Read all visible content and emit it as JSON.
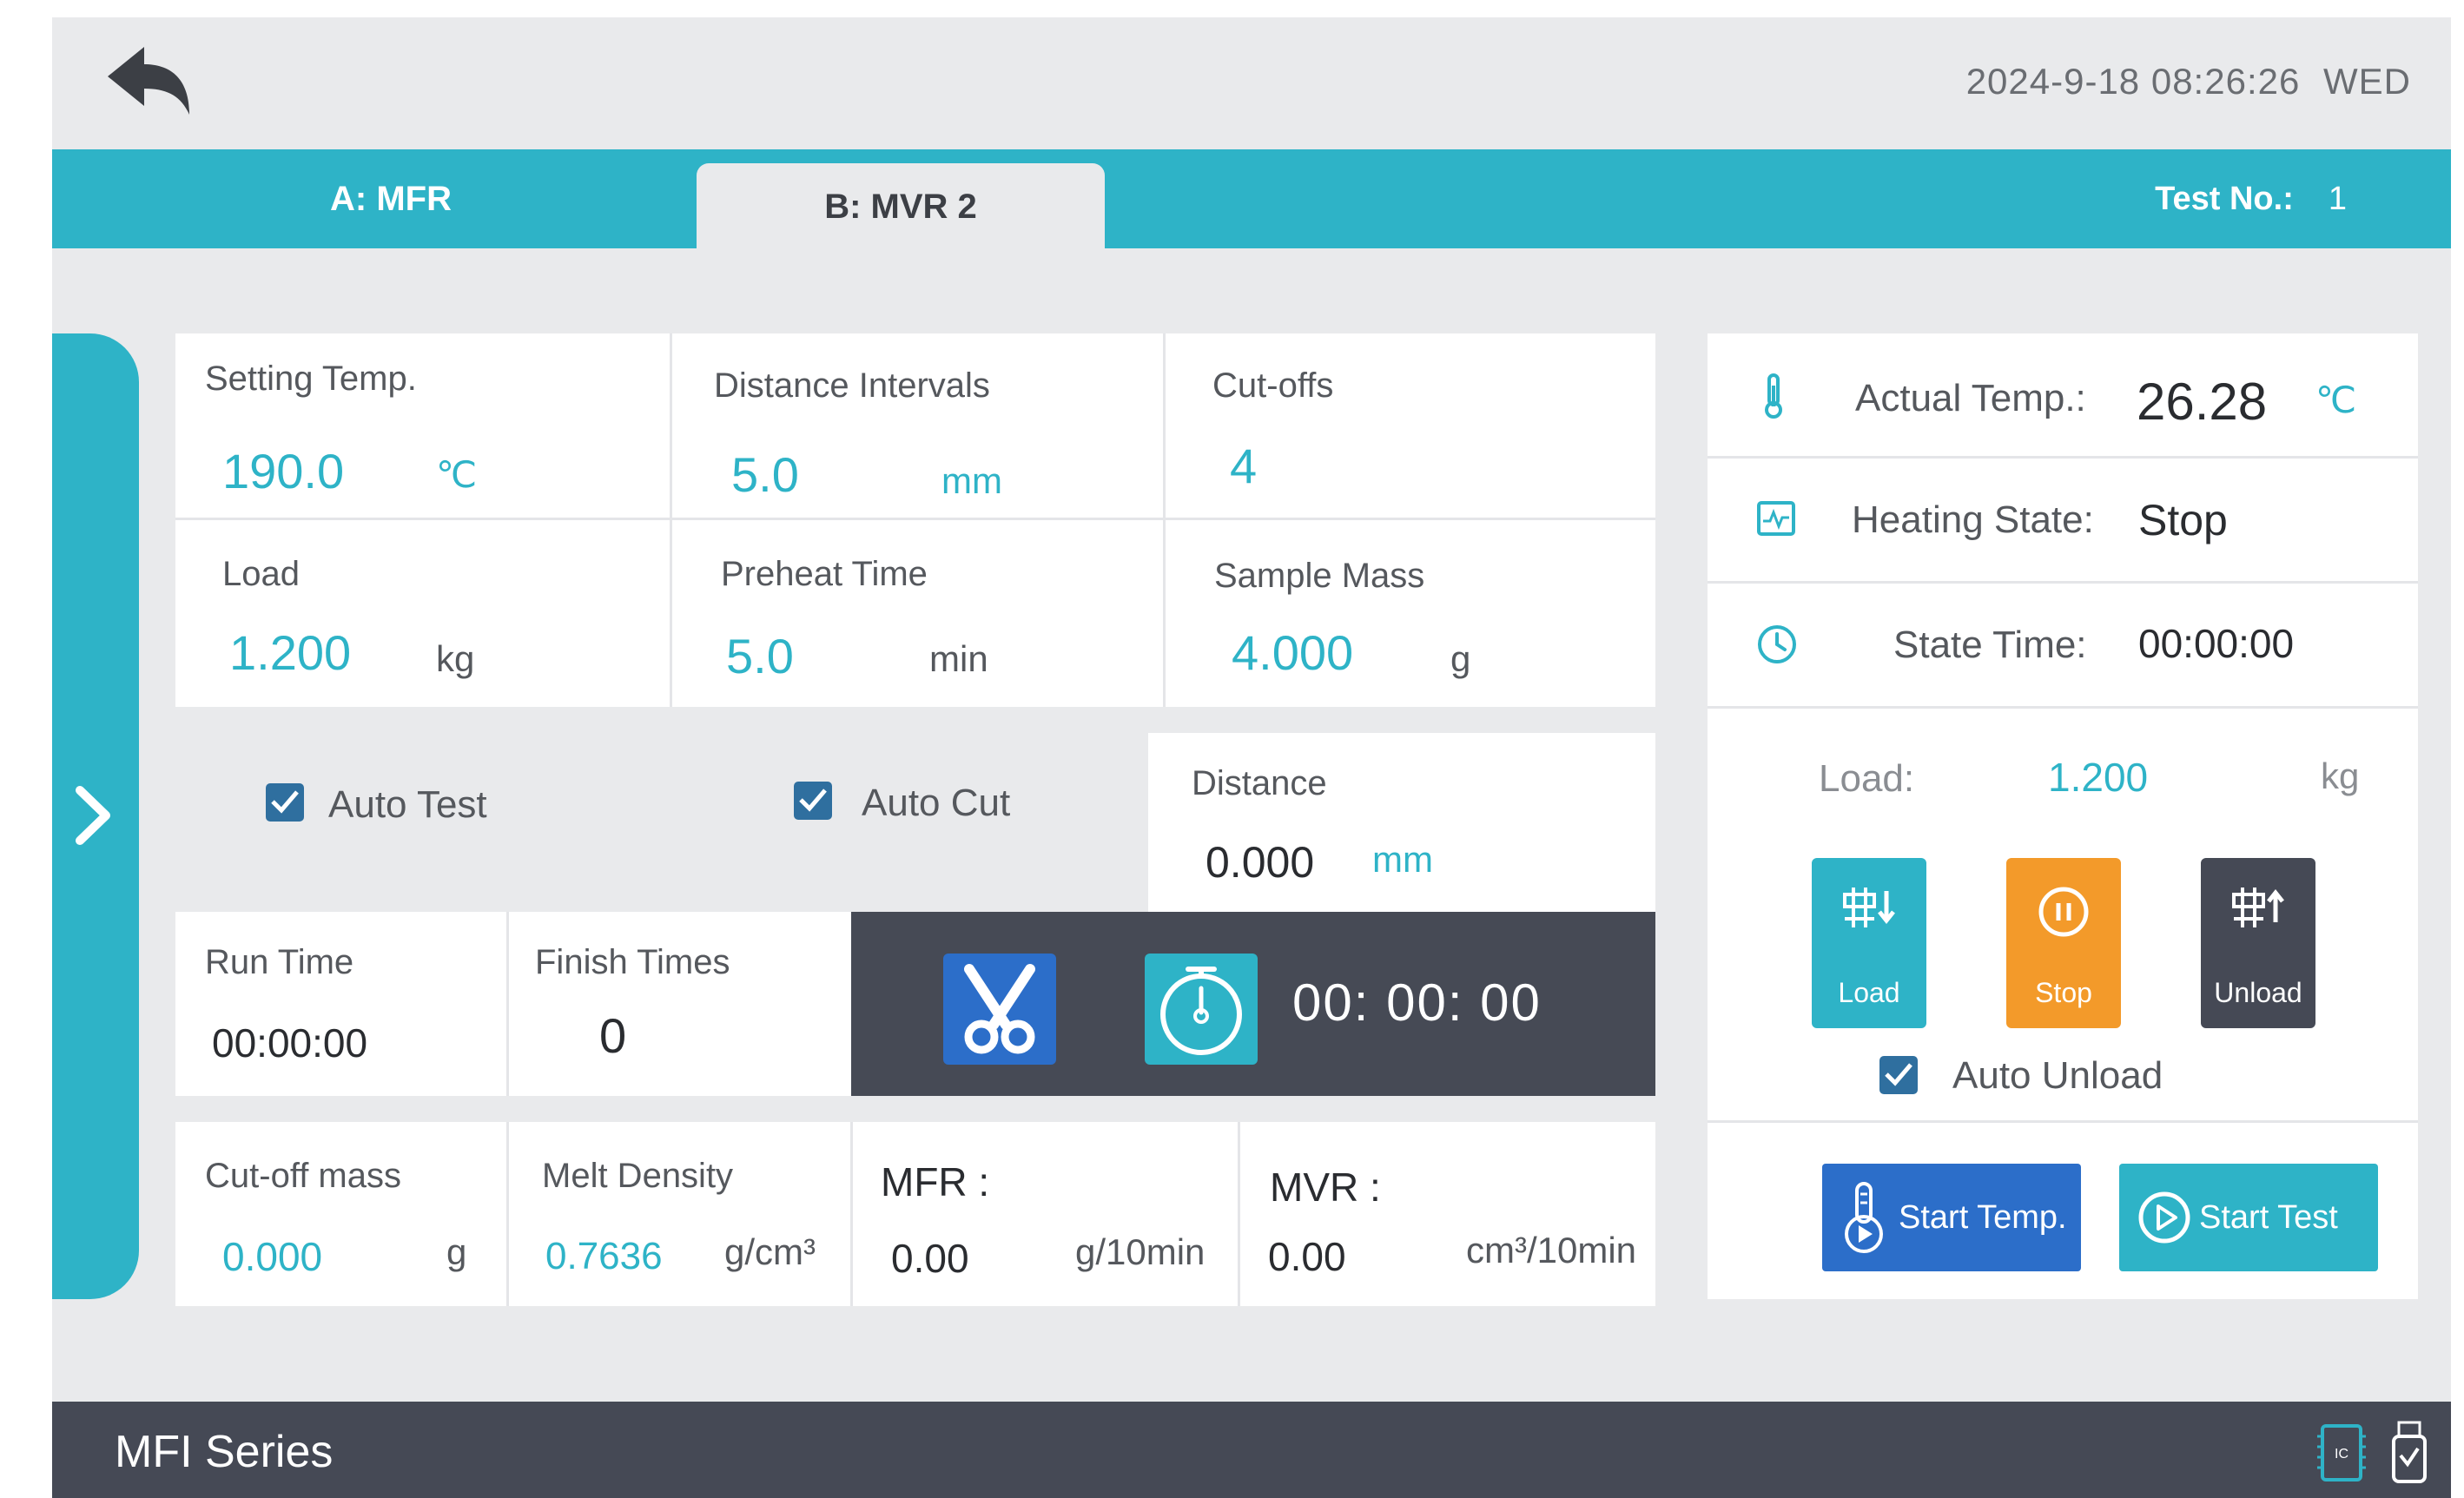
{
  "header": {
    "datetime": "2024-9-18 08:26:26",
    "weekday": "WED"
  },
  "tabs": [
    {
      "label": "A:  MFR",
      "active": false
    },
    {
      "label": "B:  MVR 2",
      "active": true
    }
  ],
  "test_no": {
    "label": "Test No.:",
    "value": "1"
  },
  "params": {
    "setting_temp": {
      "label": "Setting Temp.",
      "value": "190.0",
      "unit": "℃"
    },
    "distance_intervals": {
      "label": "Distance Intervals",
      "value": "5.0",
      "unit": "mm"
    },
    "cut_offs": {
      "label": "Cut-offs",
      "value": "4"
    },
    "load": {
      "label": "Load",
      "value": "1.200",
      "unit": "kg"
    },
    "preheat_time": {
      "label": "Preheat Time",
      "value": "5.0",
      "unit": "min"
    },
    "sample_mass": {
      "label": "Sample Mass",
      "value": "4.000",
      "unit": "g"
    }
  },
  "options": {
    "auto_test": {
      "label": "Auto Test",
      "checked": true
    },
    "auto_cut": {
      "label": "Auto Cut",
      "checked": true
    }
  },
  "distance": {
    "label": "Distance",
    "value": "0.000",
    "unit": "mm"
  },
  "run_time": {
    "label": "Run Time",
    "value": "00:00:00"
  },
  "finish_times": {
    "label": "Finish Times",
    "value": "0"
  },
  "timer": {
    "value": "00: 00: 00"
  },
  "results": {
    "cutoff_mass": {
      "label": "Cut-off mass",
      "value": "0.000",
      "unit": "g"
    },
    "melt_density": {
      "label": "Melt Density",
      "value": "0.7636",
      "unit": "g/cm³"
    },
    "mfr": {
      "label": "MFR :",
      "value": "0.00",
      "unit": "g/10min"
    },
    "mvr": {
      "label": "MVR :",
      "value": "0.00",
      "unit": "cm³/10min"
    }
  },
  "status": {
    "actual_temp": {
      "label": "Actual Temp.:",
      "value": "26.28",
      "unit": "℃"
    },
    "heating_state": {
      "label": "Heating State:",
      "value": "Stop"
    },
    "state_time": {
      "label": "State Time:",
      "value": "00:00:00"
    },
    "load": {
      "label": "Load:",
      "value": "1.200",
      "unit": "kg"
    }
  },
  "actions": {
    "load": "Load",
    "stop": "Stop",
    "unload": "Unload",
    "auto_unload": {
      "label": "Auto Unload",
      "checked": true
    },
    "start_temp": "Start Temp.",
    "start_test": "Start Test"
  },
  "colors": {
    "accent": "#2eb3c7",
    "stop": "#f39a2a",
    "dark": "#454955",
    "blue": "#2c6ec9"
  },
  "footer": {
    "series": "MFI Series",
    "chip_label": "IC"
  }
}
